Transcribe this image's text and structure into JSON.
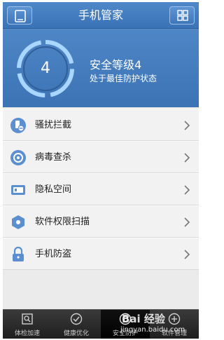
{
  "header": {
    "title": "手机管家",
    "left_icon": "phone-icon",
    "right_icon": "grid-icon"
  },
  "security": {
    "level_number": "4",
    "level_title": "安全等级4",
    "status": "处于最佳防护状态"
  },
  "menu": {
    "items": [
      {
        "label": "骚扰拦截",
        "icon": "harassment-block-icon"
      },
      {
        "label": "病毒查杀",
        "icon": "virus-scan-icon"
      },
      {
        "label": "隐私空间",
        "icon": "privacy-space-icon"
      },
      {
        "label": "软件权限扫描",
        "icon": "permission-scan-icon"
      },
      {
        "label": "手机防盗",
        "icon": "anti-theft-lock-icon"
      }
    ]
  },
  "tabs": [
    {
      "label": "体检加速",
      "icon": "checkup-icon"
    },
    {
      "label": "健康优化",
      "icon": "optimize-icon"
    },
    {
      "label": "安全防护",
      "icon": "protection-icon"
    },
    {
      "label": "软件管理",
      "icon": "software-manage-icon"
    }
  ],
  "watermark": {
    "main": "Bai 经验",
    "url": "jingyan.baidu.com"
  },
  "colors": {
    "header_blue": "#3c73b5",
    "ring_blue": "#7fc2ff",
    "list_bg": "#f2f2f2",
    "tabbar_bg": "#1f1f1f"
  }
}
